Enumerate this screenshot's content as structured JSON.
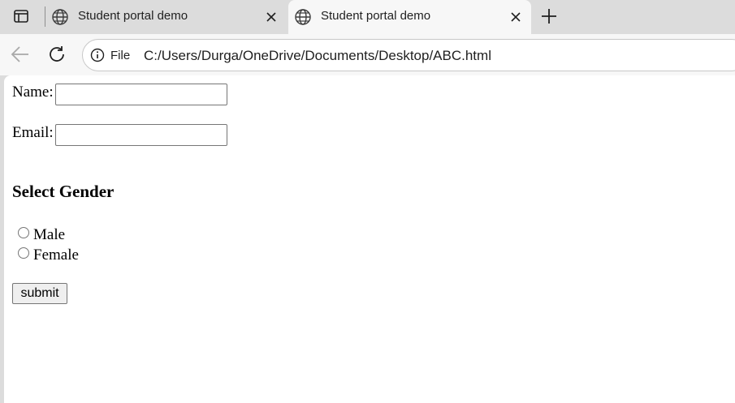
{
  "browser": {
    "tabs": [
      {
        "title": "Student portal demo",
        "active": false
      },
      {
        "title": "Student portal demo",
        "active": true
      }
    ],
    "address_bar": {
      "scheme_label": "File",
      "url": "C:/Users/Durga/OneDrive/Documents/Desktop/ABC.html"
    }
  },
  "form": {
    "name_label": "Name:",
    "name_value": "",
    "email_label": "Email:",
    "email_value": "",
    "gender_heading": "Select Gender",
    "gender_options": [
      {
        "label": "Male",
        "checked": false
      },
      {
        "label": "Female",
        "checked": false
      }
    ],
    "submit_label": "submit"
  },
  "colors": {
    "chrome_bg": "#dcdcdc",
    "toolbar_bg": "#f7f7f7",
    "page_bg": "#ffffff",
    "control_border": "#767676"
  }
}
